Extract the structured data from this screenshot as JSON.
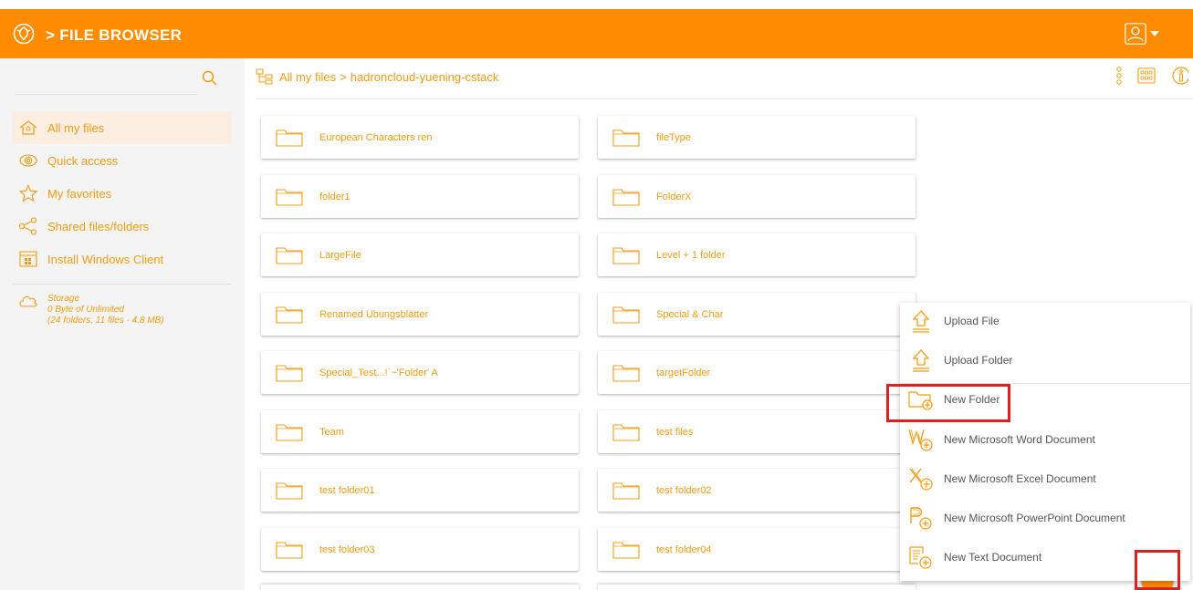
{
  "header": {
    "title": "> FILE BROWSER"
  },
  "search": {
    "placeholder": ""
  },
  "sidebar": {
    "items": [
      {
        "label": "All my files",
        "icon": "home-icon"
      },
      {
        "label": "Quick access",
        "icon": "eye-icon"
      },
      {
        "label": "My favorites",
        "icon": "star-icon"
      },
      {
        "label": "Shared files/folders",
        "icon": "share-icon"
      },
      {
        "label": "Install Windows Client",
        "icon": "windows-client-icon"
      }
    ],
    "storage": {
      "title": "Storage",
      "usage": "0 Byte of Unlimited",
      "details": "(24 folders, 11 files - 4.8 MB)"
    }
  },
  "breadcrumb": {
    "root": "All my files",
    "separator": ">",
    "current": "hadroncloud-yuening-cstack"
  },
  "folders": [
    "European Characters ren",
    "fileType",
    "folder1",
    "FolderX",
    "LargeFile",
    "Level + 1 folder",
    "Renamed Übungsblätter",
    "Special & Char",
    "Special_Test...!`~'Folder' A",
    "targetFolder",
    "Team",
    "test files",
    "test folder01",
    "test folder02",
    "test folder03",
    "test folder04"
  ],
  "menu": {
    "items": [
      {
        "label": "Upload File",
        "icon": "upload-file-icon"
      },
      {
        "label": "Upload Folder",
        "icon": "upload-folder-icon"
      },
      {
        "label": "New Folder",
        "icon": "new-folder-icon"
      },
      {
        "label": "New Microsoft Word Document",
        "icon": "word-icon"
      },
      {
        "label": "New Microsoft Excel Document",
        "icon": "excel-icon"
      },
      {
        "label": "New Microsoft PowerPoint Document",
        "icon": "powerpoint-icon"
      },
      {
        "label": "New Text Document",
        "icon": "text-doc-icon"
      }
    ]
  },
  "colors": {
    "accent": "#ff8c00",
    "text_accent": "#f39c12",
    "highlight": "#e02020"
  }
}
